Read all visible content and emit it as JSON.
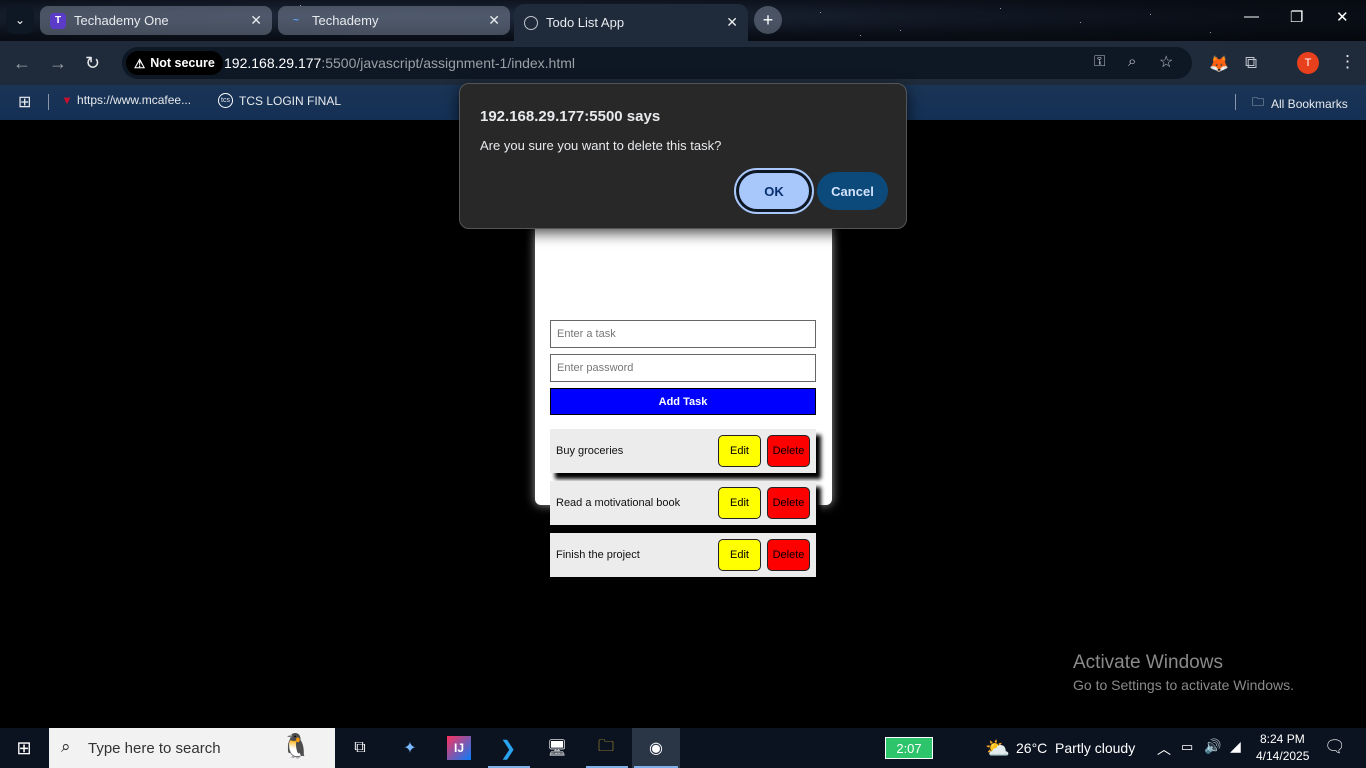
{
  "browser": {
    "tabs": [
      {
        "title": "Techademy One",
        "favicon": "techademy-t-icon",
        "active": false
      },
      {
        "title": "Techademy",
        "favicon": "techademy-icon",
        "active": false
      },
      {
        "title": "Todo List App",
        "favicon": "globe-icon",
        "active": true
      }
    ],
    "new_tab": "+",
    "security_label": "Not secure",
    "url_host": "192.168.29.177",
    "url_rest": ":5500/javascript/assignment-1/index.html",
    "bookmarks": [
      {
        "label": "https://www.mcafee...",
        "icon": "mcafee-icon"
      },
      {
        "label": "TCS LOGIN FINAL",
        "icon": "tcs-icon"
      }
    ],
    "all_bookmarks": "All Bookmarks",
    "profile_initial": "T"
  },
  "page": {
    "task_placeholder": "Enter a task",
    "password_placeholder": "Enter password",
    "add_button": "Add Task",
    "tasks": [
      {
        "label": "Buy groceries",
        "edit": "Edit",
        "delete": "Delete"
      },
      {
        "label": "Read a motivational book",
        "edit": "Edit",
        "delete": "Delete"
      },
      {
        "label": "Finish the project",
        "edit": "Edit",
        "delete": "Delete"
      }
    ]
  },
  "dialog": {
    "title": "192.168.29.177:5500 says",
    "message": "Are you sure you want to delete this task?",
    "ok": "OK",
    "cancel": "Cancel"
  },
  "watermark": {
    "line1": "Activate Windows",
    "line2": "Go to Settings to activate Windows."
  },
  "taskbar": {
    "search_placeholder": "Type here to search",
    "battery_time": "2:07",
    "weather": "26°C  Partly cloudy",
    "time": "8:24 PM",
    "date": "4/14/2025"
  },
  "colors": {
    "add_button": "#0000ff",
    "edit_button": "#ffff00",
    "delete_button": "#ff0000",
    "dialog_ok": "#a8c7fa",
    "dialog_cancel": "#0b4a7a"
  }
}
